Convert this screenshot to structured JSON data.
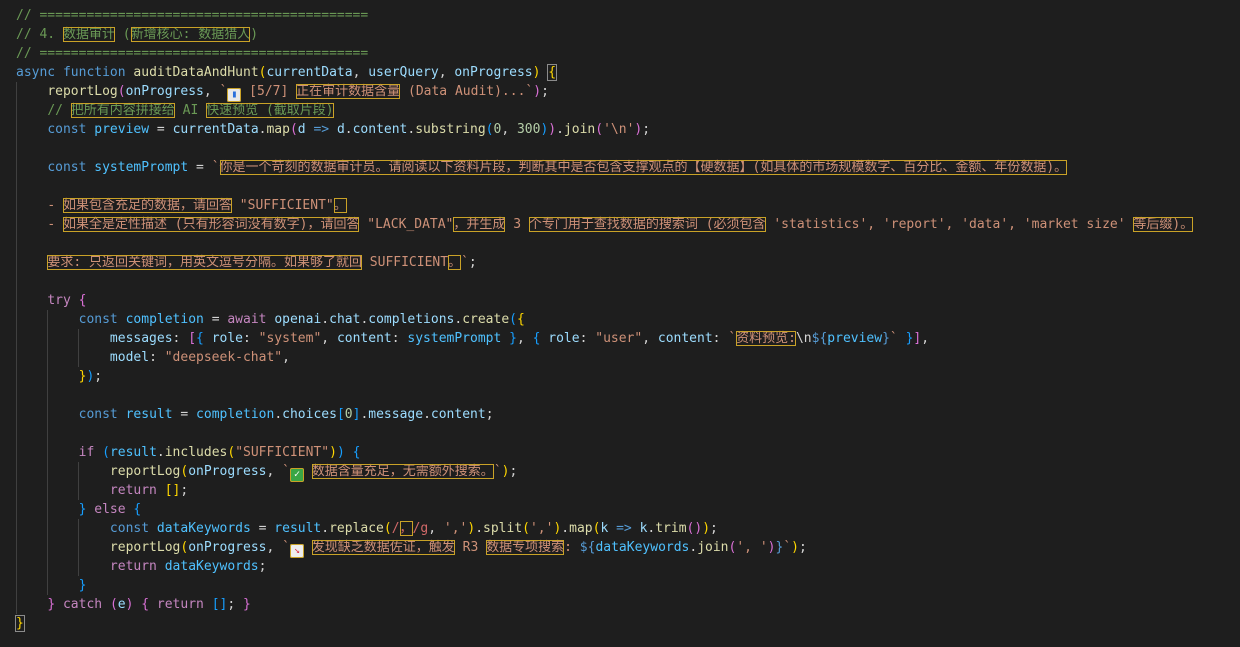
{
  "code": {
    "comment_rule": "// ==========================================",
    "comment_section_prefix": "// 4. ",
    "comment_section_title": "数据审计",
    "comment_section_paren_open": " (",
    "comment_section_subtitle": "新增核心: 数据猎人",
    "comment_section_paren_close": ")",
    "kw_async": "async",
    "kw_function": "function",
    "fn_audit": "auditDataAndHunt",
    "param_currentData": "currentData",
    "param_userQuery": "userQuery",
    "param_onProgress": "onProgress",
    "fn_reportLog": "reportLog",
    "log1_icon": "chart-emoji",
    "log1_step": " [5/7] ",
    "log1_text": "正在审计数据含量",
    "log1_suffix": " (Data Audit)...",
    "comment2_prefix": "// ",
    "comment2_a": "把所有内容拼接给",
    "comment2_mid": " AI ",
    "comment2_b": "快速预览 (截取片段)",
    "kw_const": "const",
    "var_preview": "preview",
    "fn_map": "map",
    "var_d": "d",
    "prop_content": "content",
    "fn_substring": "substring",
    "num_0": "0",
    "num_300": "300",
    "fn_join": "join",
    "str_newline": "'\\n'",
    "var_systemPrompt": "systemPrompt",
    "prompt_line1": "你是一个苛刻的数据审计员。请阅读以下资料片段，判断其中是否包含支撑观点的【硬数据】(如具体的市场规模数字、百分比、金额、年份数据)。",
    "prompt_line2_dash": "- ",
    "prompt_line2_a": "如果包含充足的数据，请回答",
    "prompt_line2_b": " \"SUFFICIENT\"",
    "prompt_line2_c": "。",
    "prompt_line3_dash": "- ",
    "prompt_line3_a": "如果全是定性描述 (只有形容词没有数字)，请回答",
    "prompt_line3_b": " \"LACK_DATA\"",
    "prompt_line3_c": "，并生成",
    "prompt_line3_d": " 3 ",
    "prompt_line3_e": "个专门用于查找数据的搜索词 (必须包含",
    "prompt_line3_f": " 'statistics', 'report', 'data', 'market size' ",
    "prompt_line3_g": "等后缀)。",
    "prompt_line4_a": "要求: 只返回关键词，用英文逗号分隔。如果够了就回",
    "prompt_line4_b": " SUFFICIENT",
    "prompt_line4_c": "。",
    "kw_try": "try",
    "var_completion": "completion",
    "kw_await": "await",
    "obj_openai": "openai",
    "prop_chat": "chat",
    "prop_completions": "completions",
    "fn_create": "create",
    "prop_messages": "messages",
    "prop_role": "role",
    "str_system": "\"system\"",
    "str_user": "\"user\"",
    "tpl_preview_label": "资料预览:",
    "tpl_preview_nl": "\\n",
    "tpl_preview_var": "preview",
    "prop_model": "model",
    "str_model": "\"deepseek-chat\"",
    "var_result": "result",
    "prop_choices": "choices",
    "prop_message": "message",
    "kw_if": "if",
    "fn_includes": "includes",
    "str_sufficient": "\"SUFFICIENT\"",
    "log2_icon": "check-emoji",
    "log2_text": "数据含量充足，无需额外搜索。",
    "kw_return": "return",
    "kw_else": "else",
    "var_dataKeywords": "dataKeywords",
    "fn_replace": "replace",
    "regex_open": "/",
    "regex_char": "，",
    "regex_close": "/g",
    "str_comma": "','",
    "fn_split": "split",
    "var_k": "k",
    "fn_trim": "trim",
    "log3_icon": "chart-down-emoji",
    "log3_text_a": "发现缺乏数据佐证，触发",
    "log3_text_b": " R3 ",
    "log3_text_c": "数据专项搜索",
    "log3_text_d": ": ",
    "str_join_sep": "', '",
    "kw_catch": "catch",
    "var_e": "e",
    "icons": {
      "chart_glyph": "▮",
      "check_glyph": "✓",
      "down_glyph": "↘"
    },
    "colors": {
      "background": "#1e1e1e",
      "comment": "#6a9955",
      "keyword": "#569cd6",
      "string": "#ce9178",
      "function": "#dcdcaa",
      "variable": "#9cdcfe",
      "highlight_outline": "#c9a227"
    }
  }
}
